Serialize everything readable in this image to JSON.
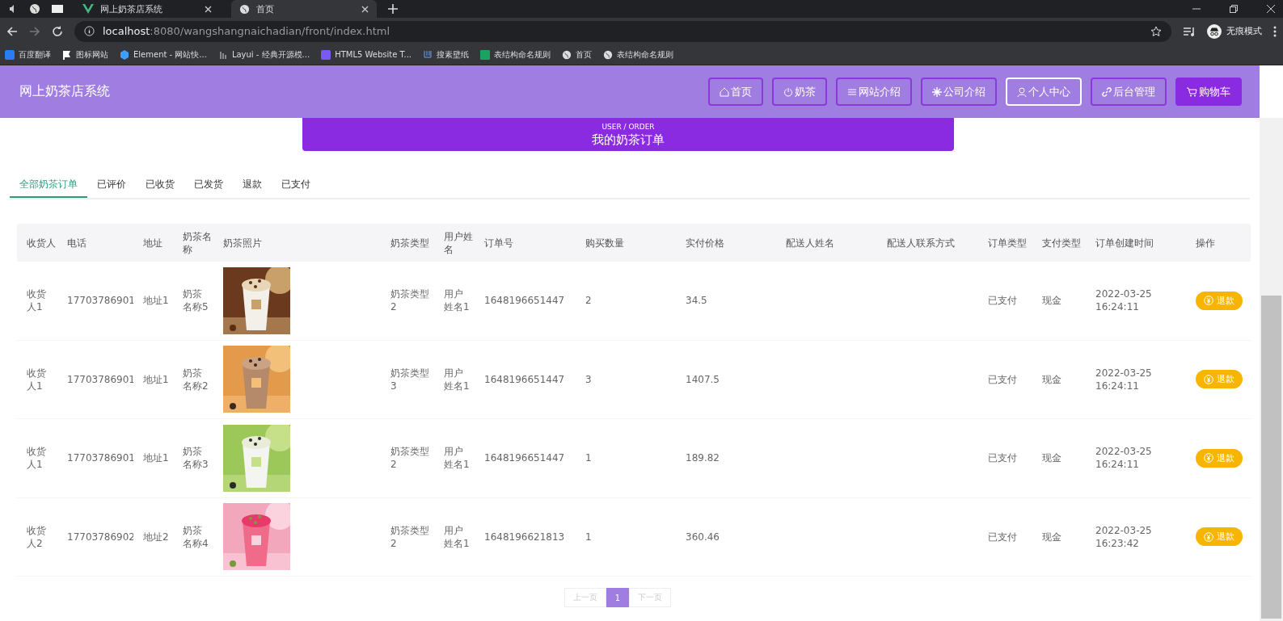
{
  "browser": {
    "tabs": [
      {
        "title": "网上奶茶店系统",
        "selected": false
      },
      {
        "title": "首页",
        "selected": true
      }
    ],
    "address": {
      "host": "localhost",
      "rest": ":8080/wangshangnaichadian/front/index.html"
    },
    "incognito": "无痕模式",
    "bookmarks": [
      "百度翻译",
      "图标网站",
      "Element - 网站快...",
      "Layui - 经典开源模...",
      "HTML5 Website T...",
      "搜素壁纸",
      "表结构命名规则",
      "首页",
      "表结构命名规则"
    ]
  },
  "header": {
    "title": "网上奶茶店系统",
    "nav": [
      {
        "label": "首页",
        "kind": "outline",
        "selected": false
      },
      {
        "label": "奶茶",
        "kind": "outline",
        "selected": false
      },
      {
        "label": "网站介绍",
        "kind": "outline",
        "selected": false
      },
      {
        "label": "公司介绍",
        "kind": "outline",
        "selected": false
      },
      {
        "label": "个人中心",
        "kind": "outline",
        "selected": true
      },
      {
        "label": "后台管理",
        "kind": "outline",
        "selected": false
      },
      {
        "label": "购物车",
        "kind": "filled",
        "selected": false
      }
    ]
  },
  "banner": {
    "subtitle": "USER / ORDER",
    "title": "我的奶茶订单"
  },
  "tabs": [
    {
      "label": "全部奶茶订单",
      "selected": true
    },
    {
      "label": "已评价",
      "selected": false
    },
    {
      "label": "已收货",
      "selected": false
    },
    {
      "label": "已发货",
      "selected": false
    },
    {
      "label": "退款",
      "selected": false
    },
    {
      "label": "已支付",
      "selected": false
    }
  ],
  "table": {
    "columns": [
      "收货人",
      "电话",
      "地址",
      "奶茶名称",
      "奶茶照片",
      "奶茶类型",
      "用户姓名",
      "订单号",
      "购买数量",
      "实付价格",
      "配送人姓名",
      "配送人联系方式",
      "订单类型",
      "支付类型",
      "订单创建时间",
      "操作"
    ],
    "rows": [
      {
        "cells": [
          {
            "kind": "text",
            "text": "收货人1"
          },
          {
            "kind": "text",
            "text": "17703786901"
          },
          {
            "kind": "text",
            "text": "地址1"
          },
          {
            "kind": "text",
            "text": "奶茶名称5"
          },
          {
            "kind": "picture"
          },
          {
            "kind": "text",
            "text": "奶茶类型2"
          },
          {
            "kind": "text",
            "text": "用户姓名1"
          },
          {
            "kind": "text",
            "text": "1648196651447"
          },
          {
            "kind": "text",
            "text": "2"
          },
          {
            "kind": "text",
            "text": "34.5"
          },
          {
            "kind": "empty"
          },
          {
            "kind": "empty"
          },
          {
            "kind": "text",
            "text": "已支付"
          },
          {
            "kind": "text",
            "text": "现金"
          },
          {
            "kind": "text",
            "text": "2022-03-25 16:24:11"
          },
          {
            "kind": "button",
            "text": "退款"
          }
        ]
      },
      {
        "cells": [
          {
            "kind": "text",
            "text": "收货人1"
          },
          {
            "kind": "text",
            "text": "17703786901"
          },
          {
            "kind": "text",
            "text": "地址1"
          },
          {
            "kind": "text",
            "text": "奶茶名称2"
          },
          {
            "kind": "picture"
          },
          {
            "kind": "text",
            "text": "奶茶类型3"
          },
          {
            "kind": "text",
            "text": "用户姓名1"
          },
          {
            "kind": "text",
            "text": "1648196651447"
          },
          {
            "kind": "text",
            "text": "3"
          },
          {
            "kind": "text",
            "text": "1407.5"
          },
          {
            "kind": "empty"
          },
          {
            "kind": "empty"
          },
          {
            "kind": "text",
            "text": "已支付"
          },
          {
            "kind": "text",
            "text": "现金"
          },
          {
            "kind": "text",
            "text": "2022-03-25 16:24:11"
          },
          {
            "kind": "button",
            "text": "退款"
          }
        ]
      },
      {
        "cells": [
          {
            "kind": "text",
            "text": "收货人1"
          },
          {
            "kind": "text",
            "text": "17703786901"
          },
          {
            "kind": "text",
            "text": "地址1"
          },
          {
            "kind": "text",
            "text": "奶茶名称3"
          },
          {
            "kind": "picture"
          },
          {
            "kind": "text",
            "text": "奶茶类型2"
          },
          {
            "kind": "text",
            "text": "用户姓名1"
          },
          {
            "kind": "text",
            "text": "1648196651447"
          },
          {
            "kind": "text",
            "text": "1"
          },
          {
            "kind": "text",
            "text": "189.82"
          },
          {
            "kind": "empty"
          },
          {
            "kind": "empty"
          },
          {
            "kind": "text",
            "text": "已支付"
          },
          {
            "kind": "text",
            "text": "现金"
          },
          {
            "kind": "text",
            "text": "2022-03-25 16:24:11"
          },
          {
            "kind": "button",
            "text": "退款"
          }
        ]
      },
      {
        "cells": [
          {
            "kind": "text",
            "text": "收货人2"
          },
          {
            "kind": "text",
            "text": "17703786902"
          },
          {
            "kind": "text",
            "text": "地址2"
          },
          {
            "kind": "text",
            "text": "奶茶名称4"
          },
          {
            "kind": "picture"
          },
          {
            "kind": "text",
            "text": "奶茶类型2"
          },
          {
            "kind": "text",
            "text": "用户姓名1"
          },
          {
            "kind": "text",
            "text": "1648196621813"
          },
          {
            "kind": "text",
            "text": "1"
          },
          {
            "kind": "text",
            "text": "360.46"
          },
          {
            "kind": "empty"
          },
          {
            "kind": "empty"
          },
          {
            "kind": "text",
            "text": "已支付"
          },
          {
            "kind": "text",
            "text": "现金"
          },
          {
            "kind": "text",
            "text": "2022-03-25 16:23:42"
          },
          {
            "kind": "button",
            "text": "退款"
          }
        ]
      }
    ]
  },
  "pagination": {
    "prev": {
      "label": "上一页",
      "disabled": true
    },
    "pages": [
      {
        "label": "1",
        "selected": true
      }
    ],
    "next": {
      "label": "下一页",
      "disabled": true
    }
  }
}
